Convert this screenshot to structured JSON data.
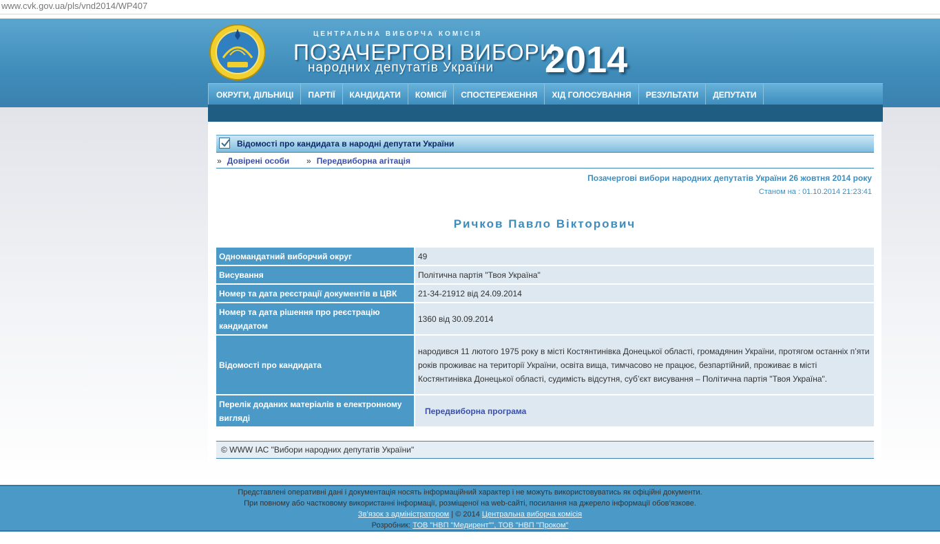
{
  "browser": {
    "url": "www.cvk.gov.ua/pls/vnd2014/WP407"
  },
  "header": {
    "org": "ЦЕНТРАЛЬНА ВИБОРЧА КОМІСІЯ",
    "title": "ПОЗАЧЕРГОВІ ВИБОРИ",
    "subtitle": "народних депутатів України",
    "year": "2014"
  },
  "nav": [
    "ОКРУГИ, ДІЛЬНИЦІ",
    "ПАРТІЇ",
    "КАНДИДАТИ",
    "КОМІСІЇ",
    "СПОСТЕРЕЖЕННЯ",
    "ХІД ГОЛОСУВАННЯ",
    "РЕЗУЛЬТАТИ",
    "ДЕПУТАТИ"
  ],
  "section": {
    "title": "Відомості про кандидата в народні депутати України"
  },
  "subnav": {
    "arrow": "»",
    "items": [
      "Довірені особи",
      "Передвиборна агітація"
    ]
  },
  "election": "Позачергові вибори народних депутатів України 26 жовтня 2014 року",
  "as_of": {
    "label": "Станом на : ",
    "value": "01.10.2014 21:23:41"
  },
  "candidate": {
    "name": "Ричков Павло Вікторович",
    "rows": [
      {
        "key": "Одномандатний виборчий округ",
        "value": "49"
      },
      {
        "key": "Висування",
        "value": "Політична партія \"Твоя Україна\""
      },
      {
        "key": "Номер та дата реєстрації документів в ЦВК",
        "value": "21-34-21912 від 24.09.2014"
      },
      {
        "key": "Номер та дата рішення про реєстрацію кандидатом",
        "value": "1360 від 30.09.2014"
      },
      {
        "key": "Відомості про кандидата",
        "value": "народився 11 лютого 1975 року в місті Костянтинівка Донецької області, громадянин України, протягом останніх п’яти років проживає на території України, освіта вища, тимчасово не працює, безпартійний, проживає в місті Костянтинівка Донецької області, судимість відсутня, суб’єкт висування – Політична партія \"Твоя Україна\"."
      },
      {
        "key": "Перелік доданих матеріалів в електронному вигляді",
        "value": "Передвиборна програма"
      }
    ]
  },
  "copyright": "© WWW ІАС \"Вибори народних депутатів України\"",
  "footer": {
    "line1": "Представлені оперативні дані і документація носять інформаційний характер і не можуть використовуватись як офіційні документи.",
    "line2": "При повному або частковому використанні інформації, розміщеної на web-сайті, посилання на джерело інформації обов’язкове.",
    "contact": "Зв’язок з адміністратором",
    "sep": " | © 2014 ",
    "cec": "Центральна виборча комісія",
    "dev_label": "Розробник: ",
    "dev": "ТОВ \"НВП \"Медирент\"\", ТОВ \"НВП \"Проком\""
  }
}
